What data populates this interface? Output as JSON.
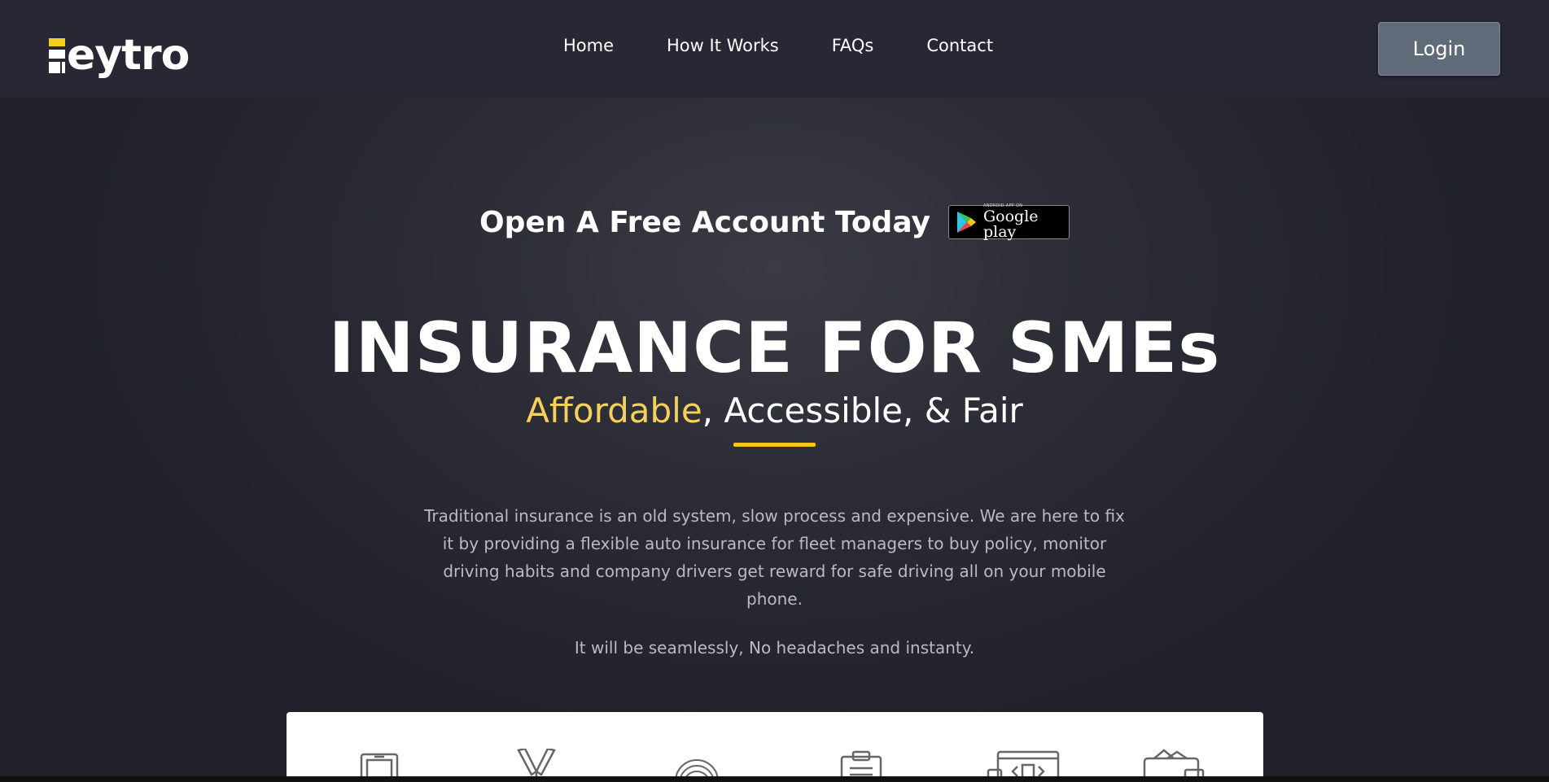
{
  "brand": {
    "logo_text": "eytro",
    "accent_color": "#f5cf1e"
  },
  "nav": {
    "links": [
      {
        "label": "Home"
      },
      {
        "label": "How It Works"
      },
      {
        "label": "FAQs"
      },
      {
        "label": "Contact"
      }
    ],
    "login_label": "Login"
  },
  "hero": {
    "cta_title": "Open A Free Account Today",
    "badge": {
      "small_text": "ANDROID APP ON",
      "big_text": "Google play"
    },
    "title": "INSURANCE FOR SMEs",
    "subtitle_accent": "Affordable",
    "subtitle_rest": ", Accessible, & Fair",
    "description": "Traditional insurance is an old system, slow process and expensive. We are here to fix it by providing a flexible auto insurance for fleet managers to buy policy, monitor driving habits and company drivers get reward for safe driving all on your mobile phone.",
    "tagline": "It will be seamlessly, No headaches and instanty."
  },
  "features": {
    "icons": [
      "tablet-icon",
      "tools-icon",
      "fingerprint-icon",
      "clipboard-icon",
      "code-browser-icon",
      "wallet-icon"
    ]
  },
  "colors": {
    "background": "#1f2029",
    "navbar": "#272834",
    "login_button": "#5f6b78",
    "accent_yellow": "#f5d05a"
  }
}
